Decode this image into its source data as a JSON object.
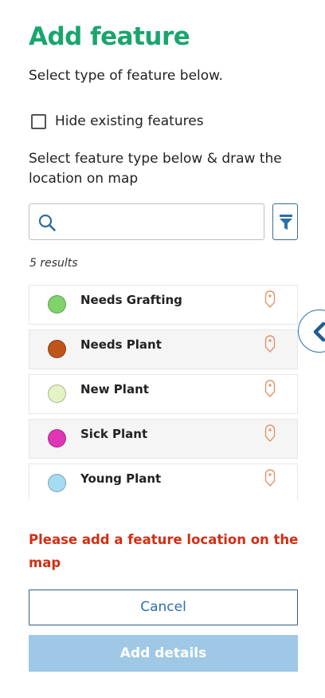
{
  "header": {
    "title": "Add feature",
    "subtitle": "Select type of feature below."
  },
  "hide_existing": {
    "label": "Hide existing features",
    "checked": false
  },
  "instructions": "Select feature type below & draw the location on map",
  "search": {
    "value": "",
    "placeholder": ""
  },
  "results_count": "5 results",
  "features": [
    {
      "label": "Needs Grafting",
      "color": "#7fd36a"
    },
    {
      "label": "Needs Plant",
      "color": "#bf5518"
    },
    {
      "label": "New Plant",
      "color": "#e4f3c4"
    },
    {
      "label": "Sick Plant",
      "color": "#e035b7"
    },
    {
      "label": "Young Plant",
      "color": "#a6dcf2"
    }
  ],
  "error_message": "Please add a feature location on the map",
  "buttons": {
    "cancel": "Cancel",
    "add_details": "Add details"
  },
  "icons": {
    "search": "search-icon",
    "filter": "filter-icon",
    "pin": "map-pin-icon",
    "collapse": "chevron-left-icon"
  },
  "colors": {
    "title": "#1aa56e",
    "error": "#d12f13",
    "primary_disabled": "#9ec8e6",
    "accent": "#2f6fae",
    "pin": "#e0956a"
  }
}
